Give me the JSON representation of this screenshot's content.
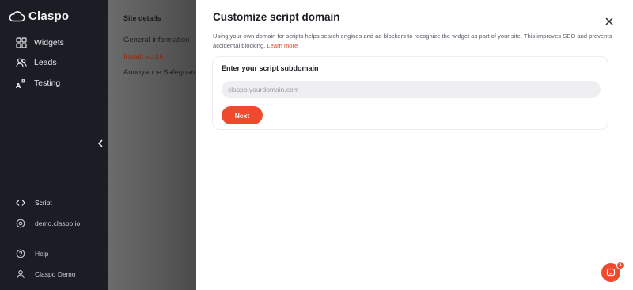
{
  "app": {
    "name": "Claspo"
  },
  "sidebar": {
    "items": [
      {
        "label": "Widgets",
        "icon": "grid-icon"
      },
      {
        "label": "Leads",
        "icon": "users-icon"
      },
      {
        "label": "Testing",
        "icon": "ab-test-icon"
      }
    ],
    "bottom": [
      {
        "label": "Script",
        "icon": "code-icon"
      },
      {
        "label": "demo.claspo.io",
        "icon": "site-icon"
      },
      {
        "label": "Help",
        "icon": "help-icon"
      },
      {
        "label": "Claspo Demo",
        "icon": "user-icon"
      }
    ]
  },
  "subpanel": {
    "title": "Site details",
    "items": [
      "General information",
      "Install script",
      "Annoyance Safeguard"
    ],
    "active": "Install script"
  },
  "modal": {
    "title": "Customize script domain",
    "description": "Using your own domain for scripts helps search engines and ad blockers to recognize the widget as part of your site. This improves SEO and prevents accidental blocking.",
    "learn_more": "Learn more",
    "field_label": "Enter your script subdomain",
    "input_placeholder": "claspo.yourdomain.com",
    "input_value": "",
    "next_label": "Next"
  },
  "chat": {
    "badge": "1"
  },
  "colors": {
    "accent": "#ef4a2d",
    "sidebar_bg": "#1b1c24"
  }
}
